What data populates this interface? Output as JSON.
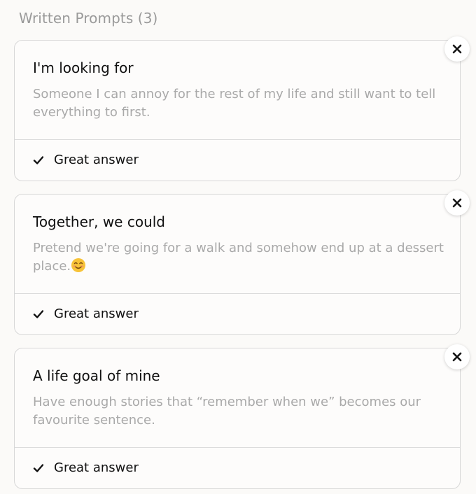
{
  "section": {
    "title": "Written Prompts (3)"
  },
  "prompts": [
    {
      "question": "I'm looking for",
      "answer": "Someone I can annoy for the rest of my life and still want to tell everything to first.",
      "feedback": "Great answer"
    },
    {
      "question": "Together, we could",
      "answer": "Pretend we're going for a walk and somehow end up at a dessert place.",
      "answer_emoji": "smiling-face-icon",
      "feedback": "Great answer"
    },
    {
      "question": "A life goal of mine",
      "answer": "Have enough stories that “remember when we” becomes our favourite sentence.",
      "feedback": "Great answer"
    }
  ],
  "icons": {
    "close": "close-icon",
    "check": "check-icon"
  },
  "colors": {
    "background": "#fbfaf8",
    "title": "#9a9a9a",
    "answer_text": "#a9a9a9",
    "border": "#d7d7d7"
  }
}
